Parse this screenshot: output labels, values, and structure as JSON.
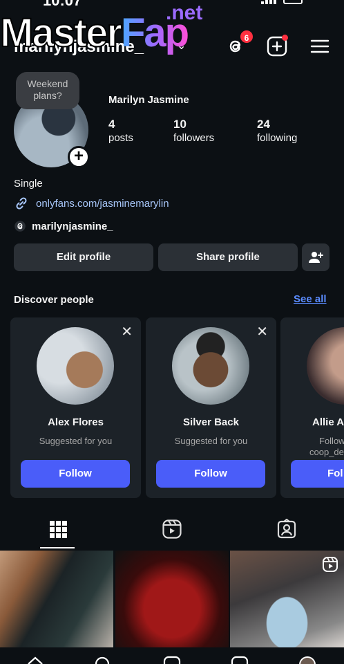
{
  "status": {
    "time": "10:07"
  },
  "watermark": {
    "main": "Master",
    "accent": "Fap",
    "tld": ".net"
  },
  "header": {
    "username": "marilynjasmine_",
    "chevron": "⌄",
    "threads_badge": "6"
  },
  "profile": {
    "note": "Weekend plans?",
    "name": "Marilyn Jasmine",
    "stats": [
      {
        "value": "4",
        "label": "posts"
      },
      {
        "value": "10",
        "label": "followers"
      },
      {
        "value": "24",
        "label": "following"
      }
    ],
    "bio": "Single",
    "link": "onlyfans.com/jasminemarylin",
    "threads_handle": "marilynjasmine_"
  },
  "buttons": {
    "edit": "Edit profile",
    "share": "Share profile"
  },
  "discover": {
    "title": "Discover people",
    "see_all": "See all",
    "cards": [
      {
        "name": "Alex Flores",
        "subtitle": "Suggested for you",
        "button": "Follow"
      },
      {
        "name": "Silver Back",
        "subtitle": "Suggested for you",
        "button": "Follow"
      },
      {
        "name": "Allie A",
        "subtitle": "Follow",
        "subtitle2": "coop_de",
        "button": "Fol"
      }
    ]
  },
  "icons": {
    "threads": "threads-icon",
    "add": "plus-square-icon",
    "menu": "hamburger-menu-icon",
    "grid": "grid-icon",
    "reels": "reels-icon",
    "tagged": "tagged-icon"
  },
  "colors": {
    "accent": "#4a5df9",
    "link": "#a8c7fa",
    "badge": "#ff3040",
    "see_all": "#5b8cff"
  }
}
